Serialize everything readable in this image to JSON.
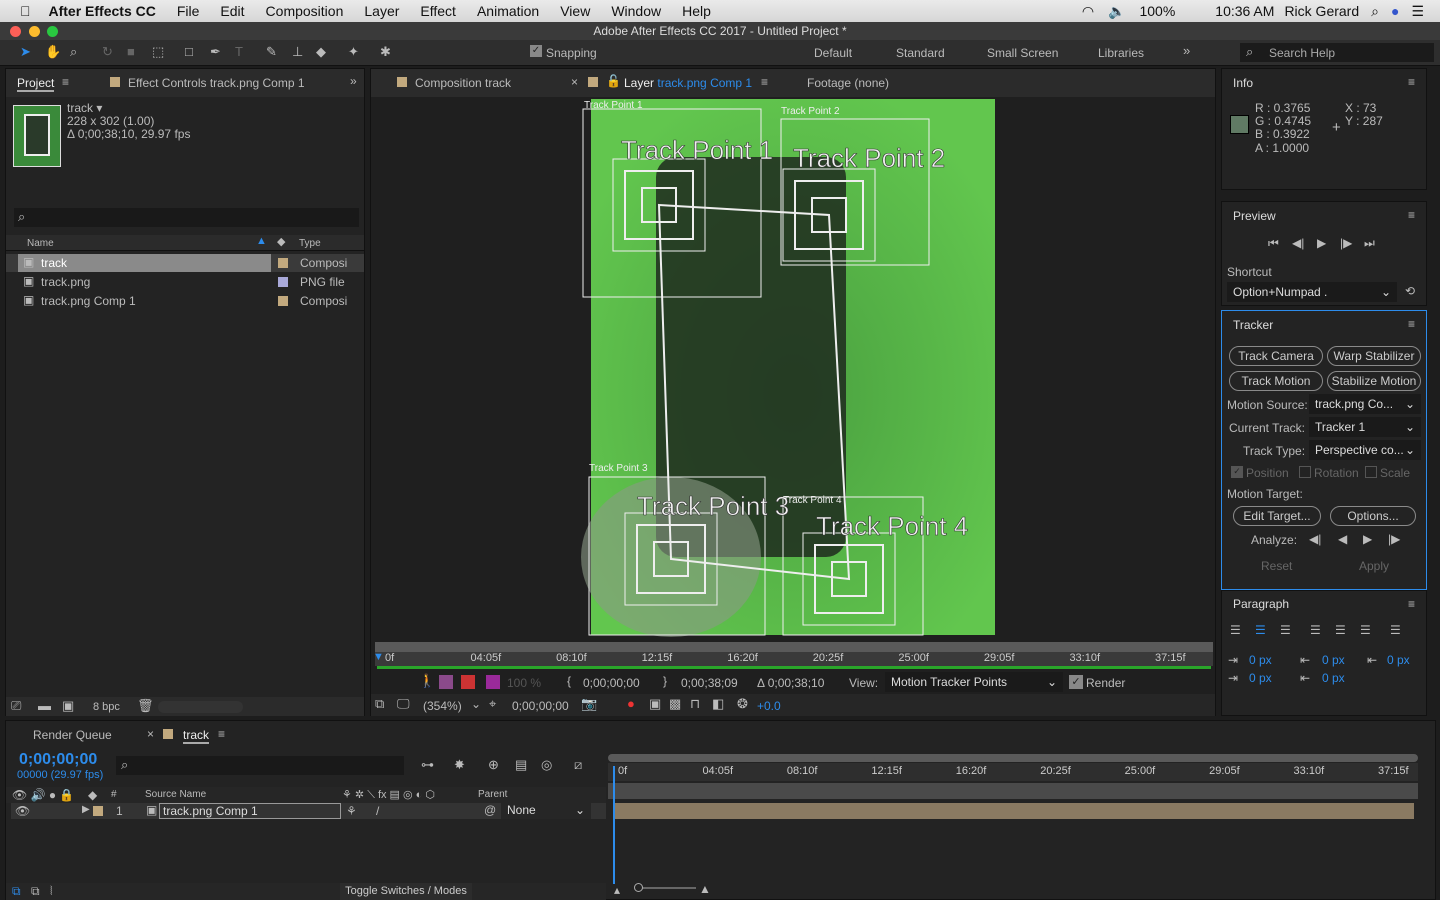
{
  "menubar": {
    "app": "After Effects CC",
    "items": [
      "File",
      "Edit",
      "Composition",
      "Layer",
      "Effect",
      "Animation",
      "View",
      "Window",
      "Help"
    ],
    "battery": "100%",
    "time": "10:36 AM",
    "user": "Rick Gerard"
  },
  "window_title": "Adobe After Effects CC 2017 - Untitled Project *",
  "toolbar": {
    "snapping": "Snapping",
    "workspaces": [
      "Default",
      "Standard",
      "Small Screen",
      "Libraries"
    ],
    "search_placeholder": "Search Help"
  },
  "project": {
    "tab": "Project",
    "effect_tab": "Effect Controls track.png Comp 1",
    "item_name": "track ▾",
    "dims": "228 x 302 (1.00)",
    "duration": "Δ 0;00;38;10, 29.97 fps",
    "col_name": "Name",
    "col_type": "Type",
    "rows": [
      {
        "name": "track",
        "type": "Composi",
        "color": "#c2a97e"
      },
      {
        "name": "track.png",
        "type": "PNG file",
        "color": "#a9a9d9"
      },
      {
        "name": "track.png Comp 1",
        "type": "Composi",
        "color": "#c2a97e"
      }
    ],
    "bpc": "8 bpc"
  },
  "viewer": {
    "tab_comp": "Composition track",
    "tab_layer_prefix": "Layer",
    "tab_layer_name": "track.png Comp 1",
    "tab_footage": "Footage (none)",
    "track_points": [
      "Track Point 1",
      "Track Point 2",
      "Track Point 3",
      "Track Point 4"
    ],
    "ruler": [
      "0f",
      "04:05f",
      "08:10f",
      "12:15f",
      "16:20f",
      "20:25f",
      "25:00f",
      "29:05f",
      "33:10f",
      "37:15f"
    ],
    "zoom": "100 %",
    "in_time": "0;00;00;00",
    "out_time": "0;00;38;09",
    "delta": "Δ 0;00;38;10",
    "view_label": "View:",
    "view_value": "Motion Tracker Points",
    "render": "Render",
    "magnification": "(354%)",
    "current_time": "0;00;00;00",
    "exposure": "+0.0"
  },
  "info": {
    "title": "Info",
    "r": "R : 0.3765",
    "g": "G : 0.4745",
    "b": "B : 0.3922",
    "a": "A : 1.0000",
    "x": "X : 73",
    "y": "Y : 287",
    "swatch": "#607a64"
  },
  "preview": {
    "title": "Preview",
    "shortcut_label": "Shortcut",
    "shortcut_value": "Option+Numpad ."
  },
  "tracker": {
    "title": "Tracker",
    "track_camera": "Track Camera",
    "warp": "Warp Stabilizer",
    "track_motion": "Track Motion",
    "stabilize": "Stabilize Motion",
    "motion_source_label": "Motion Source:",
    "motion_source": "track.png Co...",
    "current_track_label": "Current Track:",
    "current_track": "Tracker 1",
    "track_type_label": "Track Type:",
    "track_type": "Perspective co...",
    "position": "Position",
    "rotation": "Rotation",
    "scale": "Scale",
    "motion_target": "Motion Target:",
    "edit_target": "Edit Target...",
    "options": "Options...",
    "analyze": "Analyze:",
    "reset": "Reset",
    "apply": "Apply"
  },
  "paragraph": {
    "title": "Paragraph",
    "values": [
      "0 px",
      "0 px",
      "0 px",
      "0 px",
      "0 px"
    ]
  },
  "timeline": {
    "render_queue": "Render Queue",
    "tab": "track",
    "time": "0;00;00;00",
    "frames": "00000 (29.97 fps)",
    "col_source": "Source Name",
    "col_num": "#",
    "col_parent": "Parent",
    "layer_num": "1",
    "layer_name": "track.png Comp 1",
    "parent": "None",
    "toggle": "Toggle Switches / Modes",
    "ruler": [
      "0f",
      "04:05f",
      "08:10f",
      "12:15f",
      "16:20f",
      "20:25f",
      "25:00f",
      "29:05f",
      "33:10f",
      "37:15f"
    ]
  },
  "colors": {
    "accent": "#2d8ceb",
    "footage_green": "#5fc24a",
    "layer_bar": "#8a7a62"
  }
}
